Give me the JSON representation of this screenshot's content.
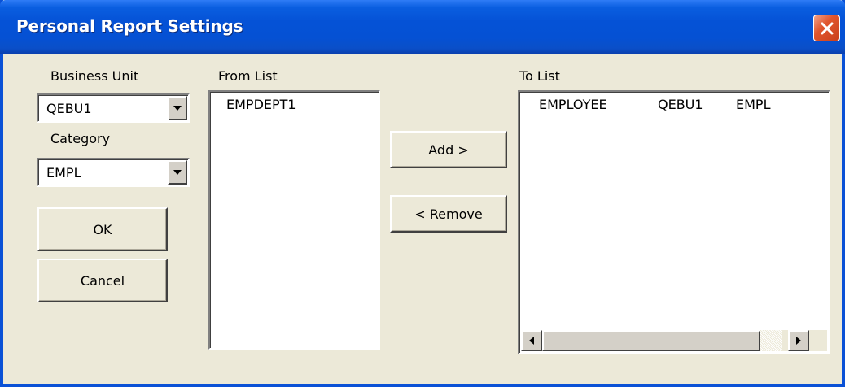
{
  "window": {
    "title": "Personal Report Settings"
  },
  "business_unit": {
    "label": "Business Unit",
    "value": "QEBU1"
  },
  "category": {
    "label": "Category",
    "value": "EMPL"
  },
  "buttons": {
    "ok": "OK",
    "cancel": "Cancel",
    "add": "Add >",
    "remove": "< Remove"
  },
  "from_list": {
    "label": "From List",
    "items": [
      "EMPDEPT1"
    ]
  },
  "to_list": {
    "label": "To List",
    "rows": [
      {
        "col1": "EMPLOYEE",
        "col2": "QEBU1",
        "col3": "EMPL"
      }
    ]
  },
  "icons": {
    "close": "close-icon",
    "dropdown": "chevron-down-icon",
    "scroll_left": "arrow-left-icon",
    "scroll_right": "arrow-right-icon"
  }
}
